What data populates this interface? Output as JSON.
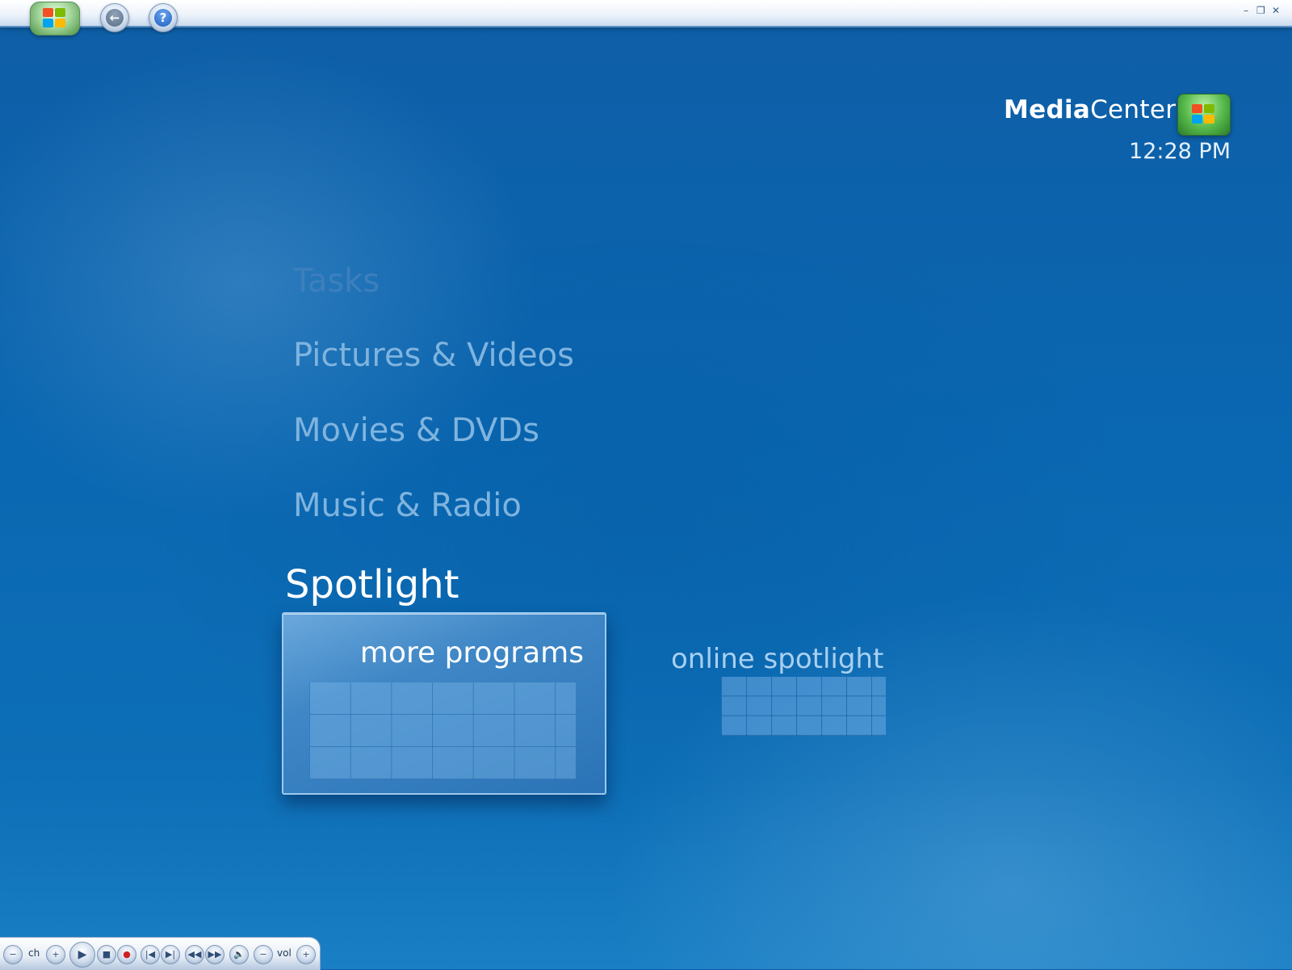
{
  "window": {
    "minimize": "–",
    "restore": "❐",
    "close": "✕"
  },
  "toolbar": {
    "back_glyph": "←",
    "help_glyph": "?"
  },
  "header": {
    "brand_bold": "Media",
    "brand_regular": "Center",
    "time": "12:28 PM"
  },
  "menu": {
    "items": [
      "Tasks",
      "Pictures & Videos",
      "Movies & DVDs",
      "Music & Radio",
      "Spotlight"
    ],
    "active_index": 4
  },
  "spotlight": {
    "tiles": [
      {
        "label": "more programs",
        "selected": true
      },
      {
        "label": "online spotlight",
        "selected": false
      }
    ]
  },
  "transport": {
    "ch_label": "ch",
    "vol_label": "vol",
    "minus": "−",
    "plus": "+",
    "play": "▶",
    "stop": "■",
    "record": "●",
    "prev": "|◀",
    "next": "▶|",
    "rewind": "◀◀",
    "ffwd": "▶▶",
    "mute": "🔈"
  },
  "colors": {
    "background": "#0a67b1",
    "menu_text": "#7fb4df",
    "active_text": "#ffffff",
    "tile_border": "#9cc9ee"
  }
}
